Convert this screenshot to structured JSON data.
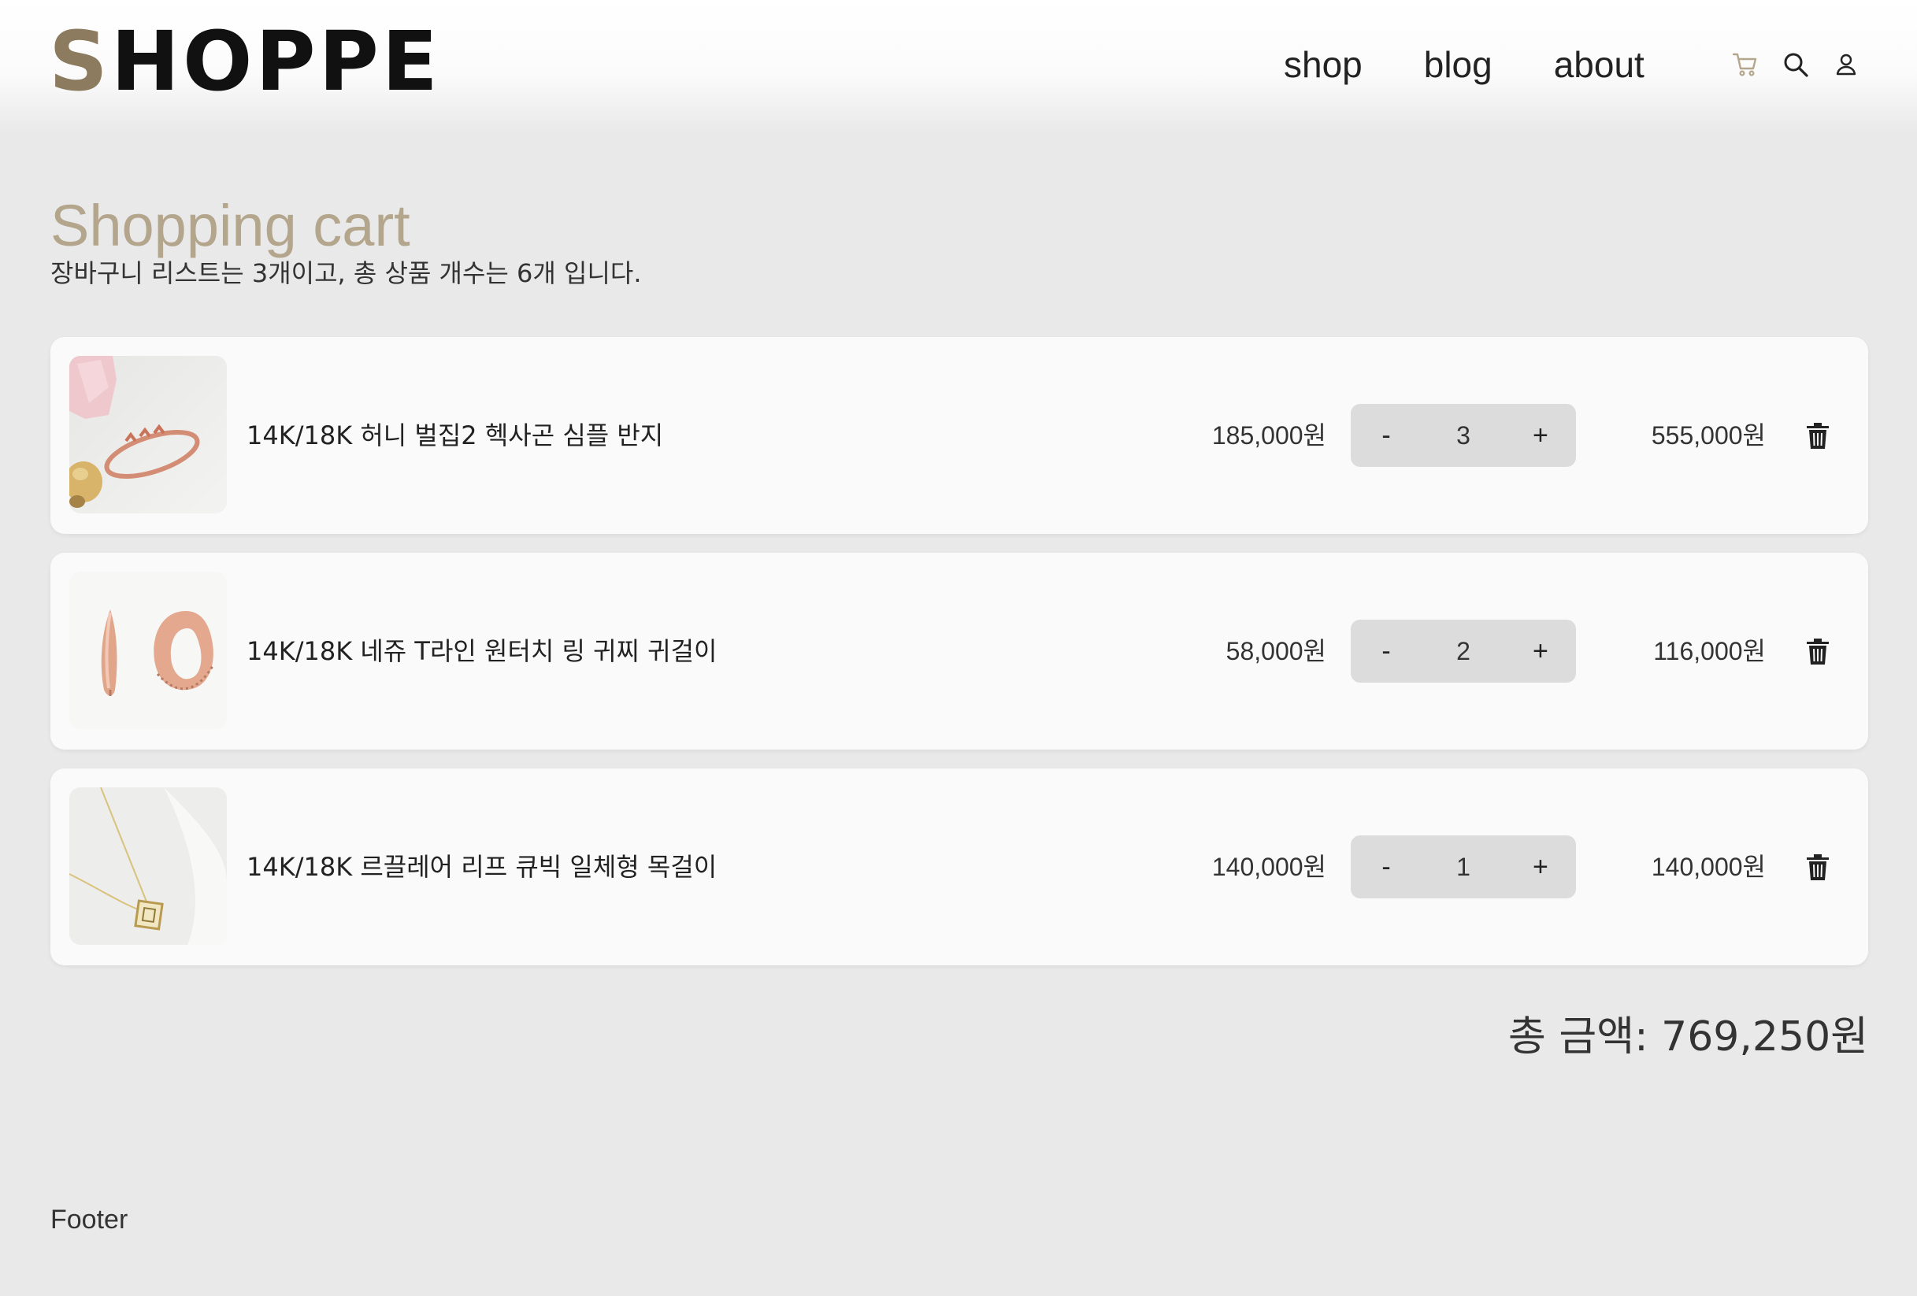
{
  "header": {
    "logo_first": "S",
    "logo_rest": "HOPPE",
    "nav": [
      "shop",
      "blog",
      "about"
    ],
    "icons": [
      "cart-icon",
      "search-icon",
      "user-icon"
    ]
  },
  "page": {
    "title": "Shopping cart",
    "summary": "장바구니 리스트는 3개이고, 총 상품 개수는 6개 입니다."
  },
  "cart": {
    "minus_label": "-",
    "plus_label": "+",
    "items": [
      {
        "name": "14K/18K 허니 벌집2 헥사곤 심플 반지",
        "unit_price": "185,000원",
        "quantity": "3",
        "line_total": "555,000원",
        "image": "ring"
      },
      {
        "name": "14K/18K 네쥬 T라인 원터치 링 귀찌 귀걸이",
        "unit_price": "58,000원",
        "quantity": "2",
        "line_total": "116,000원",
        "image": "earrings"
      },
      {
        "name": "14K/18K 르끌레어 리프 큐빅 일체형 목걸이",
        "unit_price": "140,000원",
        "quantity": "1",
        "line_total": "140,000원",
        "image": "necklace"
      }
    ],
    "grand_total": "총 금액: 769,250원"
  },
  "footer": {
    "label": "Footer"
  },
  "colors": {
    "accent": "#b4a58d",
    "logo_accent": "#8c7b5e",
    "background": "#e9e9e9",
    "card": "#fafafa",
    "qty_bg": "#dcdcdc"
  }
}
